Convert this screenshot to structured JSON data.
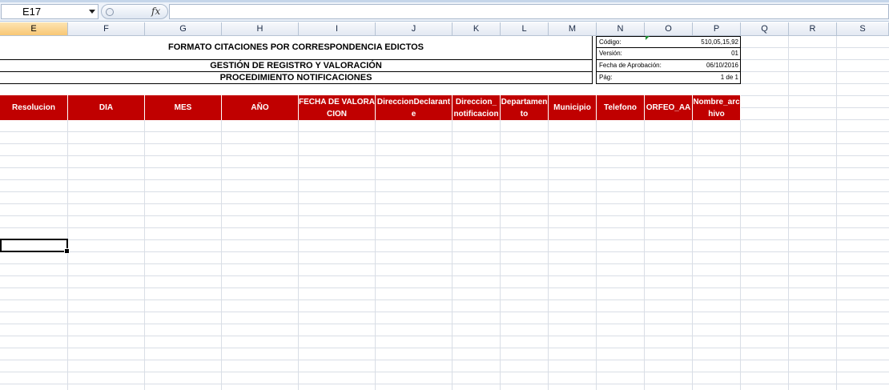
{
  "formula_bar": {
    "name_box": "E17",
    "fx_symbol": "fx",
    "formula": ""
  },
  "columns": [
    {
      "letter": "E",
      "selected": true
    },
    {
      "letter": "F"
    },
    {
      "letter": "G"
    },
    {
      "letter": "H"
    },
    {
      "letter": "I"
    },
    {
      "letter": "J"
    },
    {
      "letter": "K"
    },
    {
      "letter": "L"
    },
    {
      "letter": "M"
    },
    {
      "letter": "N"
    },
    {
      "letter": "O"
    },
    {
      "letter": "P"
    },
    {
      "letter": "Q"
    },
    {
      "letter": "R"
    },
    {
      "letter": "S"
    }
  ],
  "sheet": {
    "title1": "FORMATO CITACIONES POR CORRESPONDENCIA EDICTOS",
    "title2": "GESTIÓN DE REGISTRO Y VALORACIÓN",
    "title3": "PROCEDIMIENTO NOTIFICACIONES",
    "info": [
      {
        "label": "Código:",
        "value": "510,05,15,92"
      },
      {
        "label": "Versión:",
        "value": "01"
      },
      {
        "label": "Fecha de Aprobación:",
        "value": "06/10/2016"
      },
      {
        "label": "Pág:",
        "value": "1 de 1"
      }
    ],
    "headers": [
      "Resolucion",
      "DIA",
      "MES",
      "AÑO",
      "FECHA DE VALORACION",
      "DireccionDeclarante",
      "Direccion_ notificacion",
      "Departamento",
      "Municipio",
      "Telefono",
      "ORFEO_AA",
      "Nombre_archivo"
    ]
  },
  "colors": {
    "header_fill": "#c00000",
    "header_text": "#ffffff",
    "selected_column": "#f8c774"
  }
}
